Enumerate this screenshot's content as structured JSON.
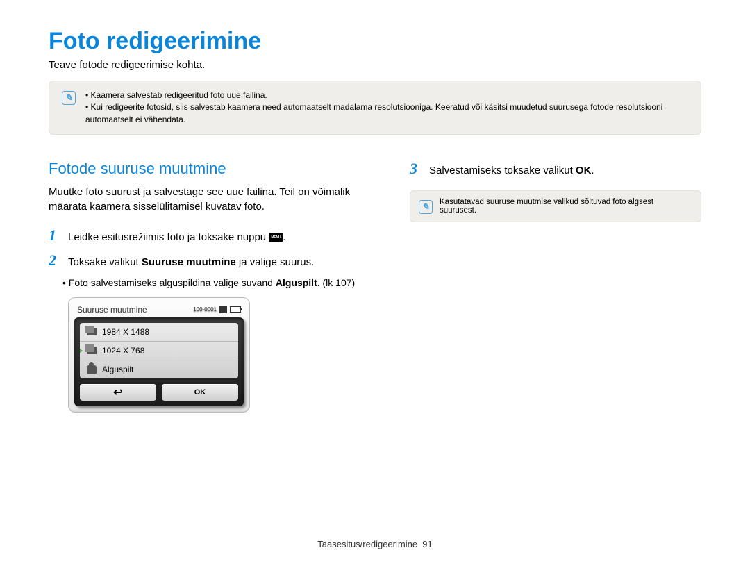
{
  "title": "Foto redigeerimine",
  "subtitle": "Teave fotode redigeerimise kohta.",
  "top_note": {
    "items": [
      "Kaamera salvestab redigeeritud foto uue failina.",
      "Kui redigeerite fotosid, siis salvestab kaamera need automaatselt madalama resolutsiooniga. Keeratud või käsitsi muudetud suurusega fotode resolutsiooni automaatselt ei vähendata."
    ]
  },
  "left": {
    "heading": "Fotode suuruse muutmine",
    "intro": "Muutke foto suurust ja salvestage see uue failina. Teil on võimalik määrata kaamera sisselülitamisel kuvatav foto.",
    "step1_num": "1",
    "step1_text_pre": "Leidke esitusrežiimis foto ja toksake nuppu ",
    "step1_menu_label": "MENU",
    "step1_text_post": ".",
    "step2_num": "2",
    "step2_text_pre": "Toksake valikut ",
    "step2_bold": "Suuruse muutmine",
    "step2_text_post": " ja valige suurus.",
    "bullet_pre": "Foto salvestamiseks alguspildina valige suvand ",
    "bullet_bold": "Alguspilt",
    "bullet_post": ". (lk 107)"
  },
  "device": {
    "header_title": "Suuruse muutmine",
    "file_number": "100-0001",
    "items": [
      {
        "label": "1984 X 1488",
        "type": "image",
        "selected": false
      },
      {
        "label": "1024 X 768",
        "type": "image",
        "selected": true
      },
      {
        "label": "Alguspilt",
        "type": "start",
        "selected": false
      }
    ],
    "ok": "OK"
  },
  "right": {
    "step3_num": "3",
    "step3_text_pre": "Salvestamiseks toksake valikut ",
    "step3_ok": "OK",
    "step3_text_post": ".",
    "note": "Kasutatavad suuruse muutmise valikud sõltuvad foto algsest suurusest."
  },
  "footer": {
    "section": "Taasesitus/redigeerimine",
    "page": "91"
  }
}
